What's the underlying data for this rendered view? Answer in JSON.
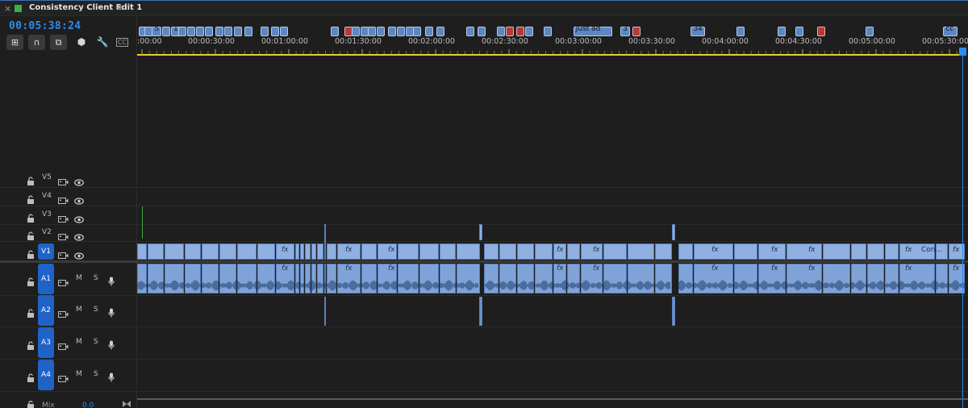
{
  "tab": {
    "title": "Consistency Client Edit 1",
    "close_glyph": "×",
    "menu_glyph": "≡",
    "color": "#3cb043"
  },
  "timecode": "00:05:38:24",
  "toolbar": {
    "tools": [
      {
        "name": "insert-nest-icon",
        "glyph": "⊞",
        "style": "btn"
      },
      {
        "name": "snap-icon",
        "glyph": "∩",
        "style": "btn"
      },
      {
        "name": "linked-selection-icon",
        "glyph": "⧉",
        "style": "btn"
      },
      {
        "name": "add-marker-icon",
        "glyph": "⬢",
        "style": "plain"
      },
      {
        "name": "wrench-icon",
        "glyph": "🔧",
        "style": "plain"
      },
      {
        "name": "captions-icon",
        "glyph": "CC",
        "style": "plain"
      }
    ]
  },
  "ruler": {
    "labels": [
      ":00:00",
      "00:00:30:00",
      "00:01:00:00",
      "00:01:30:00",
      "00:02:00:00",
      "00:02:30:00",
      "00:03:00:00",
      "00:03:30:00",
      "00:04:00:00",
      "00:04:30:00",
      "00:05:00:00",
      "00:05:30:00"
    ],
    "markers": [
      {
        "t": 0.0,
        "label": "",
        "color": "blue"
      },
      {
        "t": 0.04,
        "label": "",
        "color": "blue"
      },
      {
        "t": 0.09,
        "label": "5",
        "color": "blue"
      },
      {
        "t": 0.16,
        "label": "",
        "color": "blue"
      },
      {
        "t": 0.22,
        "label": "12",
        "color": "blue"
      },
      {
        "t": 0.27,
        "label": "",
        "color": "blue"
      },
      {
        "t": 0.33,
        "label": "",
        "color": "blue"
      },
      {
        "t": 0.39,
        "label": "",
        "color": "blue"
      },
      {
        "t": 0.45,
        "label": "",
        "color": "blue"
      },
      {
        "t": 0.52,
        "label": "",
        "color": "blue"
      },
      {
        "t": 0.58,
        "label": "",
        "color": "blue"
      },
      {
        "t": 0.65,
        "label": "",
        "color": "blue"
      },
      {
        "t": 0.72,
        "label": "",
        "color": "blue"
      },
      {
        "t": 0.83,
        "label": "",
        "color": "blue"
      },
      {
        "t": 0.9,
        "label": "",
        "color": "blue"
      },
      {
        "t": 0.96,
        "label": "",
        "color": "blue"
      },
      {
        "t": 1.31,
        "label": "",
        "color": "blue"
      },
      {
        "t": 1.4,
        "label": "",
        "color": "red"
      },
      {
        "t": 1.45,
        "label": "",
        "color": "blue"
      },
      {
        "t": 1.51,
        "label": "",
        "color": "blue"
      },
      {
        "t": 1.56,
        "label": "",
        "color": "blue"
      },
      {
        "t": 1.62,
        "label": "",
        "color": "blue"
      },
      {
        "t": 1.7,
        "label": "",
        "color": "blue"
      },
      {
        "t": 1.76,
        "label": "",
        "color": "blue"
      },
      {
        "t": 1.82,
        "label": "",
        "color": "blue"
      },
      {
        "t": 1.87,
        "label": "",
        "color": "blue"
      },
      {
        "t": 1.95,
        "label": "",
        "color": "blue"
      },
      {
        "t": 2.03,
        "label": "",
        "color": "blue"
      },
      {
        "t": 2.23,
        "label": "",
        "color": "blue"
      },
      {
        "t": 2.31,
        "label": "",
        "color": "blue"
      },
      {
        "t": 2.44,
        "label": "",
        "color": "blue"
      },
      {
        "t": 2.5,
        "label": "",
        "color": "red"
      },
      {
        "t": 2.57,
        "label": "",
        "color": "red"
      },
      {
        "t": 2.63,
        "label": "",
        "color": "blue"
      },
      {
        "t": 2.76,
        "label": "",
        "color": "blue"
      },
      {
        "t": 2.96,
        "label": "Just ad",
        "color": "blue"
      },
      {
        "t": 3.28,
        "label": "3",
        "color": "blue"
      },
      {
        "t": 3.36,
        "label": "",
        "color": "red"
      },
      {
        "t": 3.76,
        "label": "34",
        "color": "blue"
      },
      {
        "t": 4.07,
        "label": "",
        "color": "blue"
      },
      {
        "t": 4.35,
        "label": "",
        "color": "blue"
      },
      {
        "t": 4.47,
        "label": "",
        "color": "blue"
      },
      {
        "t": 4.62,
        "label": "",
        "color": "red"
      },
      {
        "t": 4.95,
        "label": "",
        "color": "blue"
      },
      {
        "t": 5.48,
        "label": "cc",
        "color": "blue"
      }
    ]
  },
  "tracks": {
    "video": [
      {
        "name": "V5",
        "targeted": false
      },
      {
        "name": "V4",
        "targeted": false
      },
      {
        "name": "V3",
        "targeted": false
      },
      {
        "name": "V2",
        "targeted": false
      },
      {
        "name": "V1",
        "targeted": true
      }
    ],
    "audio": [
      {
        "name": "A1",
        "mute": "M",
        "solo": "S"
      },
      {
        "name": "A2",
        "mute": "M",
        "solo": "S"
      },
      {
        "name": "A3",
        "mute": "M",
        "solo": "S"
      },
      {
        "name": "A4",
        "mute": "M",
        "solo": "S"
      }
    ],
    "mix": {
      "label": "Mix",
      "value": "0.0"
    }
  },
  "clips": {
    "fx_label": "fx",
    "named_clip_label": "Con...",
    "v1_fx_count": 12,
    "a1_fx_count": 12
  },
  "colors": {
    "accent": "#2d8ceb",
    "track_target": "#1f63c8",
    "clip": "#8fb0e0",
    "yellow_workarea": "#e5d02a",
    "marker_red": "#b33a3a"
  }
}
